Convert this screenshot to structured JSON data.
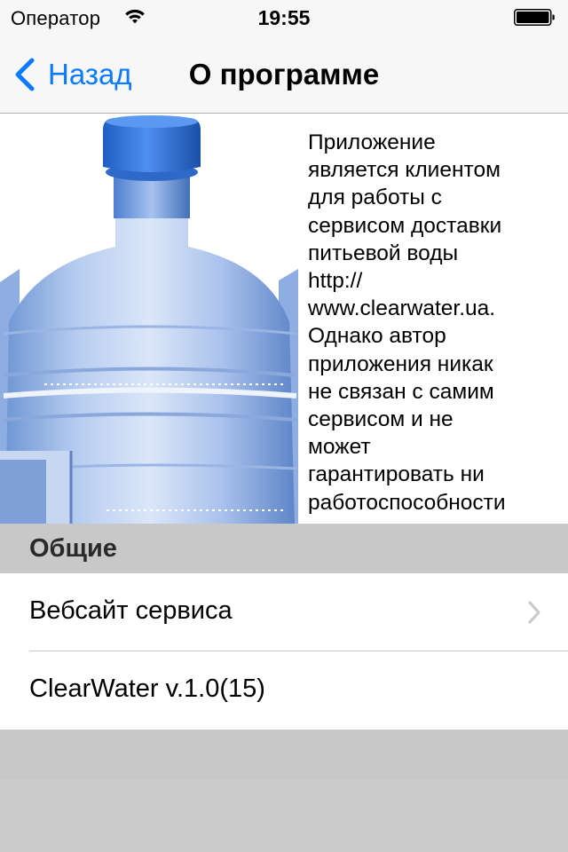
{
  "status_bar": {
    "carrier": "Оператор",
    "time": "19:55",
    "wifi_icon": "wifi-icon",
    "battery_icon": "battery-icon"
  },
  "nav_bar": {
    "back_label": "Назад",
    "title": "О программе",
    "accent_color": "#0A7AFF"
  },
  "about": {
    "image": "water-bottle-image",
    "description": "Приложение\nявляется клиентом\nдля работы с\nсервисом доставки\nпитьевой воды\nhttp://\nwww.clearwater.ua.\nОднако автор\nприложения никак\nне связан с самим\nсервисом и не\nможет\nгарантировать ни\nработоспособности"
  },
  "section": {
    "title": "Общие",
    "items": [
      {
        "label": "Вебсайт сервиса",
        "accessory": "chevron-right-icon"
      },
      {
        "label": "ClearWater v.1.0(15)"
      }
    ]
  }
}
